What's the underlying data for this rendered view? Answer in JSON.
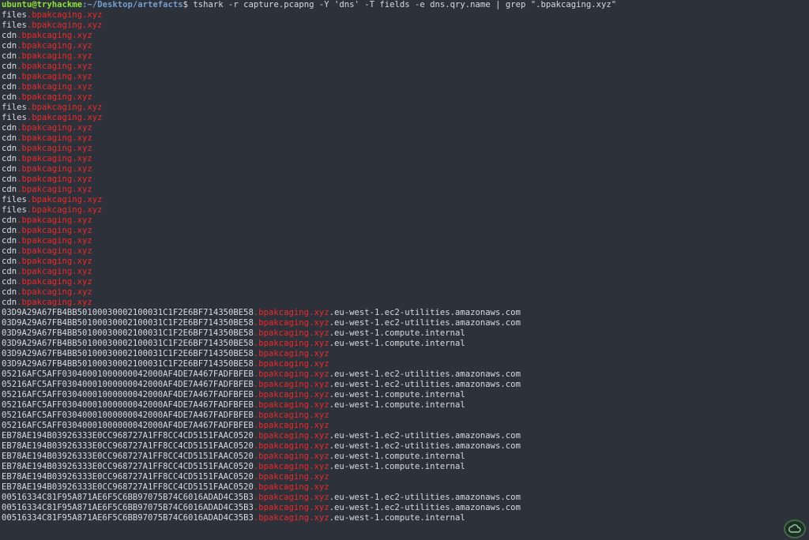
{
  "prompt": {
    "user_host": "ubuntu@tryhackme",
    "path": ":~/Desktop/artefacts",
    "symbol": "$ ",
    "command": "tshark -r capture.pcapng -Y 'dns' -T fields -e dns.qry.name | grep \".bpakcaging.xyz\""
  },
  "output": [
    [
      "files",
      ".bpakcaging.xyz",
      ""
    ],
    [
      "files",
      ".bpakcaging.xyz",
      ""
    ],
    [
      "cdn",
      ".bpakcaging.xyz",
      ""
    ],
    [
      "cdn",
      ".bpakcaging.xyz",
      ""
    ],
    [
      "cdn",
      ".bpakcaging.xyz",
      ""
    ],
    [
      "cdn",
      ".bpakcaging.xyz",
      ""
    ],
    [
      "cdn",
      ".bpakcaging.xyz",
      ""
    ],
    [
      "cdn",
      ".bpakcaging.xyz",
      ""
    ],
    [
      "cdn",
      ".bpakcaging.xyz",
      ""
    ],
    [
      "files",
      ".bpakcaging.xyz",
      ""
    ],
    [
      "files",
      ".bpakcaging.xyz",
      ""
    ],
    [
      "cdn",
      ".bpakcaging.xyz",
      ""
    ],
    [
      "cdn",
      ".bpakcaging.xyz",
      ""
    ],
    [
      "cdn",
      ".bpakcaging.xyz",
      ""
    ],
    [
      "cdn",
      ".bpakcaging.xyz",
      ""
    ],
    [
      "cdn",
      ".bpakcaging.xyz",
      ""
    ],
    [
      "cdn",
      ".bpakcaging.xyz",
      ""
    ],
    [
      "cdn",
      ".bpakcaging.xyz",
      ""
    ],
    [
      "files",
      ".bpakcaging.xyz",
      ""
    ],
    [
      "files",
      ".bpakcaging.xyz",
      ""
    ],
    [
      "cdn",
      ".bpakcaging.xyz",
      ""
    ],
    [
      "cdn",
      ".bpakcaging.xyz",
      ""
    ],
    [
      "cdn",
      ".bpakcaging.xyz",
      ""
    ],
    [
      "cdn",
      ".bpakcaging.xyz",
      ""
    ],
    [
      "cdn",
      ".bpakcaging.xyz",
      ""
    ],
    [
      "cdn",
      ".bpakcaging.xyz",
      ""
    ],
    [
      "cdn",
      ".bpakcaging.xyz",
      ""
    ],
    [
      "cdn",
      ".bpakcaging.xyz",
      ""
    ],
    [
      "cdn",
      ".bpakcaging.xyz",
      ""
    ],
    [
      "03D9A29A67FB4BB50100030002100031C1F2E6BF714350BE58",
      ".bpakcaging.xyz",
      ".eu-west-1.ec2-utilities.amazonaws.com"
    ],
    [
      "03D9A29A67FB4BB50100030002100031C1F2E6BF714350BE58",
      ".bpakcaging.xyz",
      ".eu-west-1.ec2-utilities.amazonaws.com"
    ],
    [
      "03D9A29A67FB4BB50100030002100031C1F2E6BF714350BE58",
      ".bpakcaging.xyz",
      ".eu-west-1.compute.internal"
    ],
    [
      "03D9A29A67FB4BB50100030002100031C1F2E6BF714350BE58",
      ".bpakcaging.xyz",
      ".eu-west-1.compute.internal"
    ],
    [
      "03D9A29A67FB4BB50100030002100031C1F2E6BF714350BE58",
      ".bpakcaging.xyz",
      ""
    ],
    [
      "03D9A29A67FB4BB50100030002100031C1F2E6BF714350BE58",
      ".bpakcaging.xyz",
      ""
    ],
    [
      "05216AFC5AFF03040001000000042000AF4DE7A467FADFBFEB",
      ".bpakcaging.xyz",
      ".eu-west-1.ec2-utilities.amazonaws.com"
    ],
    [
      "05216AFC5AFF03040001000000042000AF4DE7A467FADFBFEB",
      ".bpakcaging.xyz",
      ".eu-west-1.ec2-utilities.amazonaws.com"
    ],
    [
      "05216AFC5AFF03040001000000042000AF4DE7A467FADFBFEB",
      ".bpakcaging.xyz",
      ".eu-west-1.compute.internal"
    ],
    [
      "05216AFC5AFF03040001000000042000AF4DE7A467FADFBFEB",
      ".bpakcaging.xyz",
      ".eu-west-1.compute.internal"
    ],
    [
      "05216AFC5AFF03040001000000042000AF4DE7A467FADFBFEB",
      ".bpakcaging.xyz",
      ""
    ],
    [
      "05216AFC5AFF03040001000000042000AF4DE7A467FADFBFEB",
      ".bpakcaging.xyz",
      ""
    ],
    [
      "EB78AE194B03926333E0CC968727A1FF8CC4CD5151FAAC0520",
      ".bpakcaging.xyz",
      ".eu-west-1.ec2-utilities.amazonaws.com"
    ],
    [
      "EB78AE194B03926333E0CC968727A1FF8CC4CD5151FAAC0520",
      ".bpakcaging.xyz",
      ".eu-west-1.ec2-utilities.amazonaws.com"
    ],
    [
      "EB78AE194B03926333E0CC968727A1FF8CC4CD5151FAAC0520",
      ".bpakcaging.xyz",
      ".eu-west-1.compute.internal"
    ],
    [
      "EB78AE194B03926333E0CC968727A1FF8CC4CD5151FAAC0520",
      ".bpakcaging.xyz",
      ".eu-west-1.compute.internal"
    ],
    [
      "EB78AE194B03926333E0CC968727A1FF8CC4CD5151FAAC0520",
      ".bpakcaging.xyz",
      ""
    ],
    [
      "EB78AE194B03926333E0CC968727A1FF8CC4CD5151FAAC0520",
      ".bpakcaging.xyz",
      ""
    ],
    [
      "00516334C81F95A871AE6F5C6BB97075B74C6016ADAD4C35B3",
      ".bpakcaging.xyz",
      ".eu-west-1.ec2-utilities.amazonaws.com"
    ],
    [
      "00516334C81F95A871AE6F5C6BB97075B74C6016ADAD4C35B3",
      ".bpakcaging.xyz",
      ".eu-west-1.ec2-utilities.amazonaws.com"
    ],
    [
      "00516334C81F95A871AE6F5C6BB97075B74C6016ADAD4C35B3",
      ".bpakcaging.xyz",
      ".eu-west-1.compute.internal"
    ]
  ],
  "colors": {
    "background": "#2d313a",
    "text": "#d8dade",
    "user": "#8ae234",
    "path": "#729fcf",
    "grep_match": "#ef2929"
  },
  "badge": {
    "icon": "cloud-icon"
  }
}
